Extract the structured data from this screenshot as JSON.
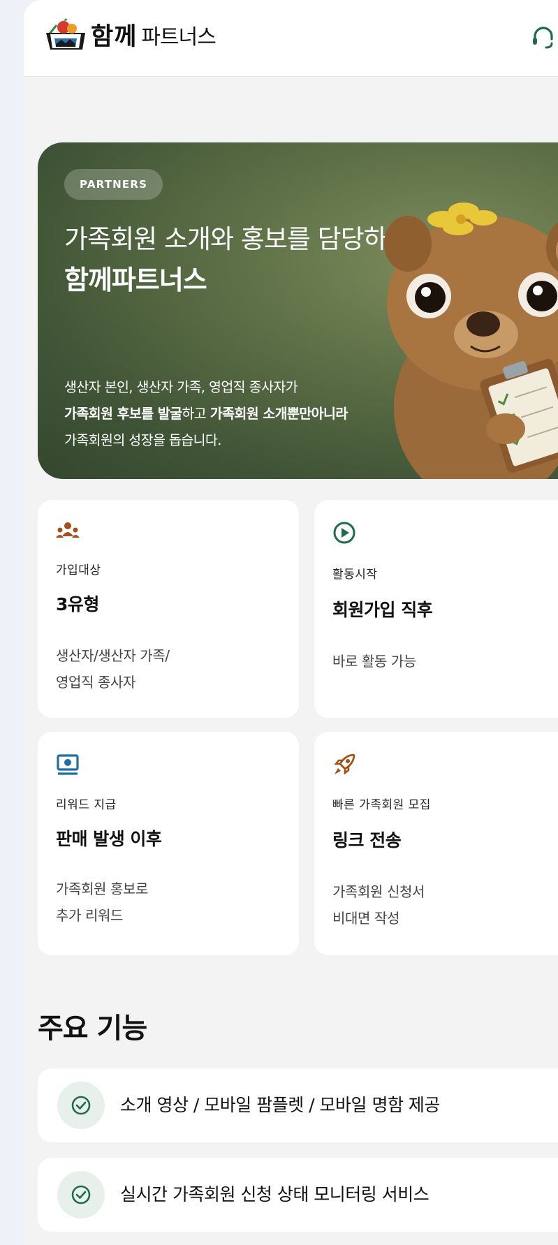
{
  "header": {
    "logo_word": "함께",
    "logo_sub": "파트너스"
  },
  "hero": {
    "badge": "PARTNERS",
    "title_line1": "가족회원 소개와 홍보를 담당하는",
    "title_line2": "함께파트너스",
    "desc_line1": "생산자 본인, 생산자 가족, 영업직 종사자가",
    "desc_line2_bold1": "가족회원 후보를 발굴",
    "desc_line2_mid": "하고 ",
    "desc_line2_bold2": "가족회원 소개뿐만아니라",
    "desc_line3": "가족회원의 성장을 돕습니다."
  },
  "cards": [
    {
      "icon": "people-group-icon",
      "label": "가입대상",
      "value": "3유형",
      "desc_line1": "생산자/생산자 가족/",
      "desc_line2": "영업직 종사자"
    },
    {
      "icon": "play-circle-icon",
      "label": "활동시작",
      "value": "회원가입 직후",
      "desc_line1": "바로 활동 가능",
      "desc_line2": ""
    },
    {
      "icon": "money-icon",
      "label": "리워드 지급",
      "value": "판매 발생 이후",
      "desc_line1": "가족회원 홍보로",
      "desc_line2": "추가 리워드"
    },
    {
      "icon": "rocket-icon",
      "label": "빠른 가족회원 모집",
      "value": "링크 전송",
      "desc_line1": "가족회원 신청서",
      "desc_line2": "비대면 작성"
    }
  ],
  "features": {
    "title": "주요 기능",
    "items": [
      {
        "icon": "check-circle-icon",
        "text": "소개 영상 / 모바일 팜플렛 / 모바일 명함 제공"
      },
      {
        "icon": "check-circle-icon",
        "text": "실시간 가족회원 신청 상태 모니터링 서비스"
      }
    ]
  },
  "colors": {
    "brand_brown": "#a0521d",
    "brand_green": "#1f6b4a",
    "hero_green": "#4d6040",
    "feature_icon_bg": "#e7f0ea"
  }
}
